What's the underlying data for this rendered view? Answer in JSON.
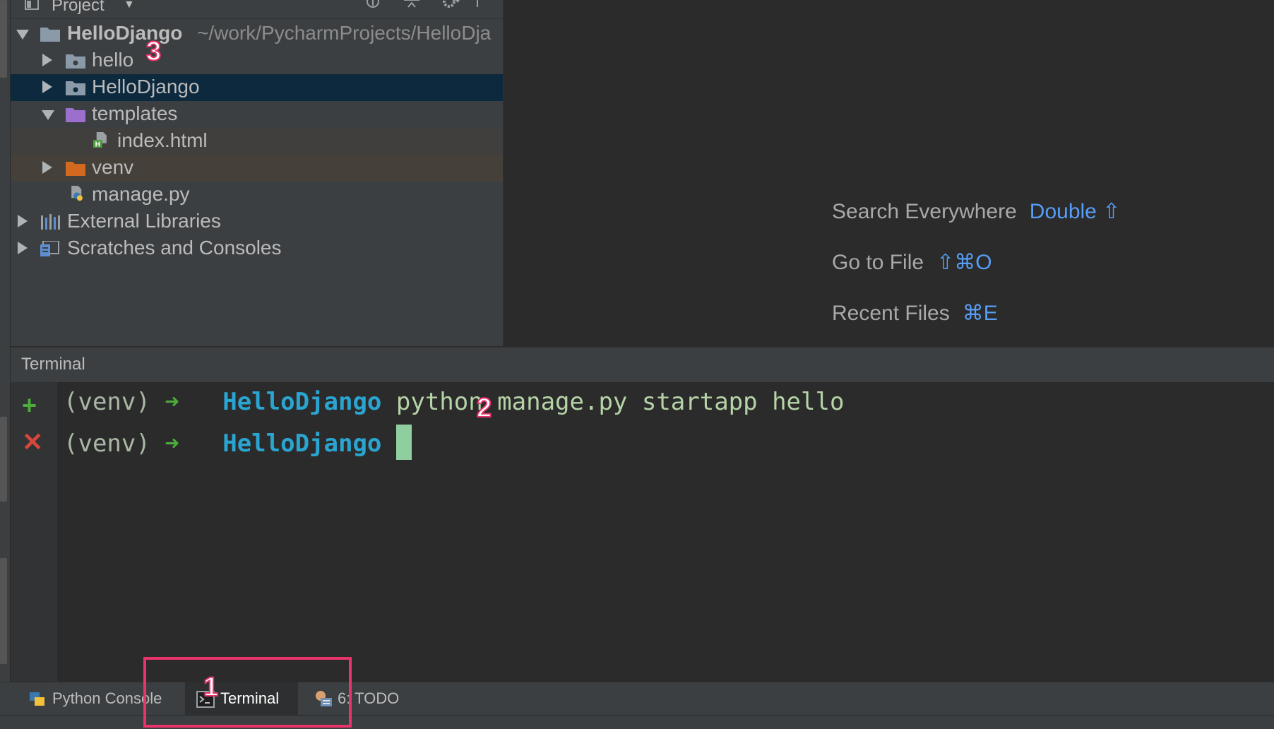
{
  "project_panel": {
    "title": "Project",
    "root": {
      "name": "HelloDjango",
      "path": "~/work/PycharmProjects/HelloDja"
    },
    "items": [
      {
        "label": "hello"
      },
      {
        "label": "HelloDjango"
      },
      {
        "label": "templates"
      },
      {
        "label": "index.html"
      },
      {
        "label": "venv"
      },
      {
        "label": "manage.py"
      },
      {
        "label": "External Libraries"
      },
      {
        "label": "Scratches and Consoles"
      }
    ]
  },
  "editor_hints": [
    {
      "label": "Search Everywhere",
      "shortcut": "Double ⇧"
    },
    {
      "label": "Go to File",
      "shortcut": "⇧⌘O"
    },
    {
      "label": "Recent Files",
      "shortcut": "⌘E"
    }
  ],
  "terminal": {
    "title": "Terminal",
    "lines": [
      {
        "venv": "(venv)",
        "arrow": "➜",
        "dir": "HelloDjango",
        "command": "python manage.py startapp hello"
      },
      {
        "venv": "(venv)",
        "arrow": "➜",
        "dir": "HelloDjango",
        "command": ""
      }
    ],
    "gutter": {
      "add": "+",
      "close": "✕"
    }
  },
  "bottom_tabs": [
    {
      "label": "Python Console"
    },
    {
      "label": "Terminal",
      "active": true
    },
    {
      "label": "6: TODO"
    }
  ],
  "annotations": {
    "n1": "1",
    "n2": "2",
    "n3": "3"
  },
  "colors": {
    "highlight": "#e8336b",
    "accent_blue": "#589df6",
    "terminal_dir": "#2aa5d1",
    "selection": "#0d293e"
  }
}
